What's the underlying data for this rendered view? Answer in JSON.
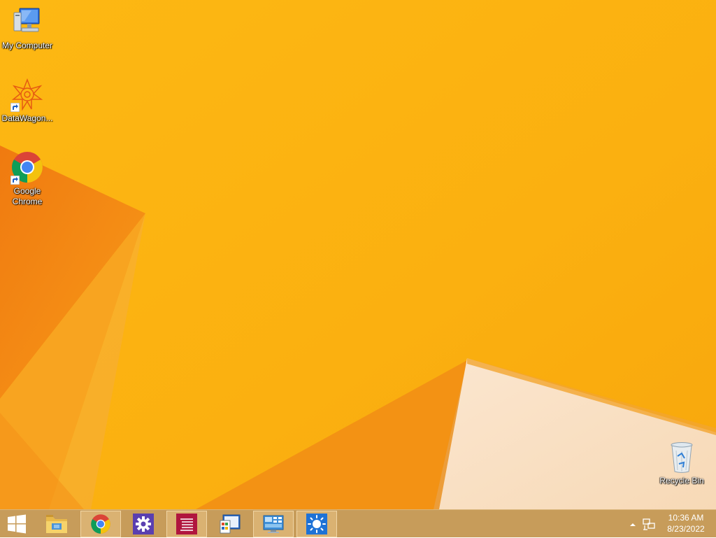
{
  "desktop": {
    "icons": [
      {
        "label": "My Computer",
        "icon": "my-computer-icon"
      },
      {
        "label": "DataWagon...",
        "icon": "datawagon-icon"
      },
      {
        "label": "Google\nChrome",
        "icon": "chrome-icon"
      },
      {
        "label": "Recycle Bin",
        "icon": "recycle-bin-icon"
      }
    ]
  },
  "taskbar": {
    "items": [
      {
        "icon": "windows-start-icon"
      },
      {
        "icon": "file-explorer-icon"
      },
      {
        "icon": "chrome-icon"
      },
      {
        "icon": "settings-gear-icon"
      },
      {
        "icon": "document-list-icon"
      },
      {
        "icon": "control-panel-icon"
      },
      {
        "icon": "display-settings-icon"
      },
      {
        "icon": "brightness-icon"
      }
    ],
    "tray": {
      "time": "10:36 AM",
      "date": "8/23/2022"
    }
  },
  "colors": {
    "wallpaper_base": "#fbb111",
    "taskbar": "#c79c5a"
  }
}
